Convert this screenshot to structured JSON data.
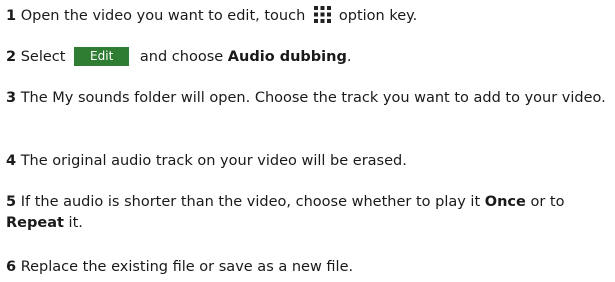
{
  "steps": [
    {
      "num": "1",
      "text_a": "Open the video you want to edit, touch",
      "icon": "menu-grid-icon",
      "text_b": "option key."
    },
    {
      "num": "2",
      "text_a": "Select",
      "button": "Edit",
      "text_b": "and choose",
      "bold": "Audio dubbing",
      "text_c": "."
    },
    {
      "num": "3",
      "text": "The My sounds folder will open. Choose the track you want to add to your video."
    },
    {
      "num": "4",
      "text": "The original audio track on your video will be erased."
    },
    {
      "num": "5",
      "text_a": "If the audio is shorter than the video, choose whether to play it",
      "bold_a": "Once",
      "text_b": "or to",
      "bold_b": "Repeat",
      "text_c": "it."
    },
    {
      "num": "6",
      "text": "Replace the existing file or save as a new file."
    }
  ],
  "colors": {
    "button_bg": "#2e7d32",
    "text": "#1a1a1a"
  }
}
